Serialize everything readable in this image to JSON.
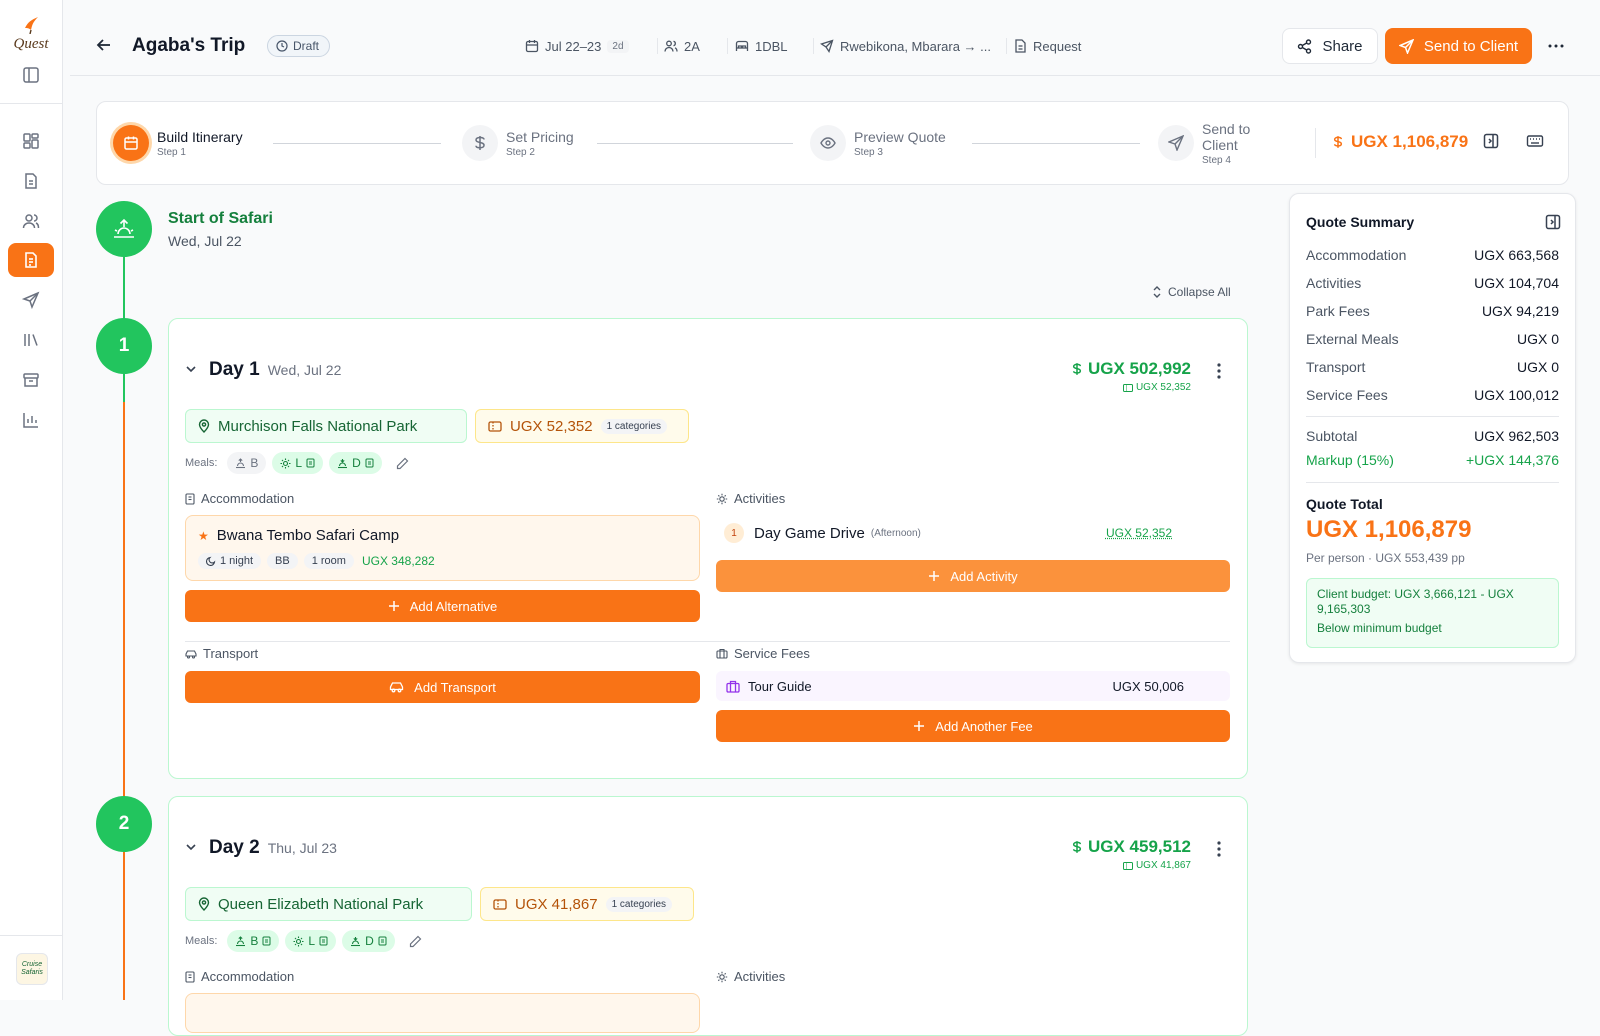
{
  "sidebar": {
    "logo_text": "Quest",
    "org_logo_text": "Cruise Safaris"
  },
  "header": {
    "title": "Agaba's Trip",
    "status": "Draft",
    "dates": "Jul 22–23",
    "days": "2d",
    "travelers": "2A",
    "rooms": "1DBL",
    "route": "Rwebikona, Mbarara → ...",
    "request": "Request",
    "share_label": "Share",
    "send_label": "Send to Client"
  },
  "stepper": {
    "steps": [
      {
        "label": "Build Itinerary",
        "sub": "Step 1"
      },
      {
        "label": "Set Pricing",
        "sub": "Step 2"
      },
      {
        "label": "Preview Quote",
        "sub": "Step 3"
      },
      {
        "label": "Send to Client",
        "sub": "Step 4"
      }
    ],
    "total": "UGX 1,106,879"
  },
  "timeline": {
    "start_title": "Start of Safari",
    "start_date": "Wed, Jul 22",
    "collapse_all": "Collapse All"
  },
  "days": [
    {
      "num": "1",
      "title": "Day 1",
      "date": "Wed, Jul 22",
      "total": "UGX 502,992",
      "sub_total": "UGX 52,352",
      "park": "Murchison Falls National Park",
      "park_fee": "UGX 52,352",
      "categories": "1 categories",
      "meals_label": "Meals:",
      "meals": [
        {
          "code": "B",
          "included": false
        },
        {
          "code": "L",
          "included": true
        },
        {
          "code": "D",
          "included": true
        }
      ],
      "accommodation_label": "Accommodation",
      "accommodation": {
        "name": "Bwana Tembo Safari Camp",
        "nights": "1 night",
        "board": "BB",
        "rooms": "1 room",
        "price": "UGX 348,282"
      },
      "add_alternative": "Add Alternative",
      "activities_label": "Activities",
      "activities": [
        {
          "num": "1",
          "name": "Day Game Drive",
          "time": "(Afternoon)",
          "price": "UGX 52,352"
        }
      ],
      "add_activity": "Add Activity",
      "transport_label": "Transport",
      "add_transport": "Add Transport",
      "service_fees_label": "Service Fees",
      "service_fee": {
        "name": "Tour Guide",
        "price": "UGX 50,006"
      },
      "add_fee": "Add Another Fee"
    },
    {
      "num": "2",
      "title": "Day 2",
      "date": "Thu, Jul 23",
      "total": "UGX 459,512",
      "sub_total": "UGX 41,867",
      "park": "Queen Elizabeth National Park",
      "park_fee": "UGX 41,867",
      "categories": "1 categories",
      "meals_label": "Meals:",
      "meals": [
        {
          "code": "B",
          "included": true
        },
        {
          "code": "L",
          "included": true
        },
        {
          "code": "D",
          "included": true
        }
      ],
      "accommodation_label": "Accommodation",
      "activities_label": "Activities"
    }
  ],
  "quote_summary": {
    "title": "Quote Summary",
    "rows": [
      {
        "label": "Accommodation",
        "value": "UGX 663,568"
      },
      {
        "label": "Activities",
        "value": "UGX 104,704"
      },
      {
        "label": "Park Fees",
        "value": "UGX 94,219"
      },
      {
        "label": "External Meals",
        "value": "UGX 0"
      },
      {
        "label": "Transport",
        "value": "UGX 0"
      },
      {
        "label": "Service Fees",
        "value": "UGX 100,012"
      }
    ],
    "subtotal_label": "Subtotal",
    "subtotal": "UGX 962,503",
    "markup_label": "Markup (15%)",
    "markup": "+UGX 144,376",
    "total_label": "Quote Total",
    "total": "UGX 1,106,879",
    "per_person": "Per person · UGX 553,439 pp",
    "budget": "Client budget: UGX 3,666,121 - UGX 9,165,303",
    "budget_note": "Below minimum budget"
  },
  "colors": {
    "accent": "#f97316",
    "success": "#22c55e",
    "success_text": "#16a34a"
  }
}
